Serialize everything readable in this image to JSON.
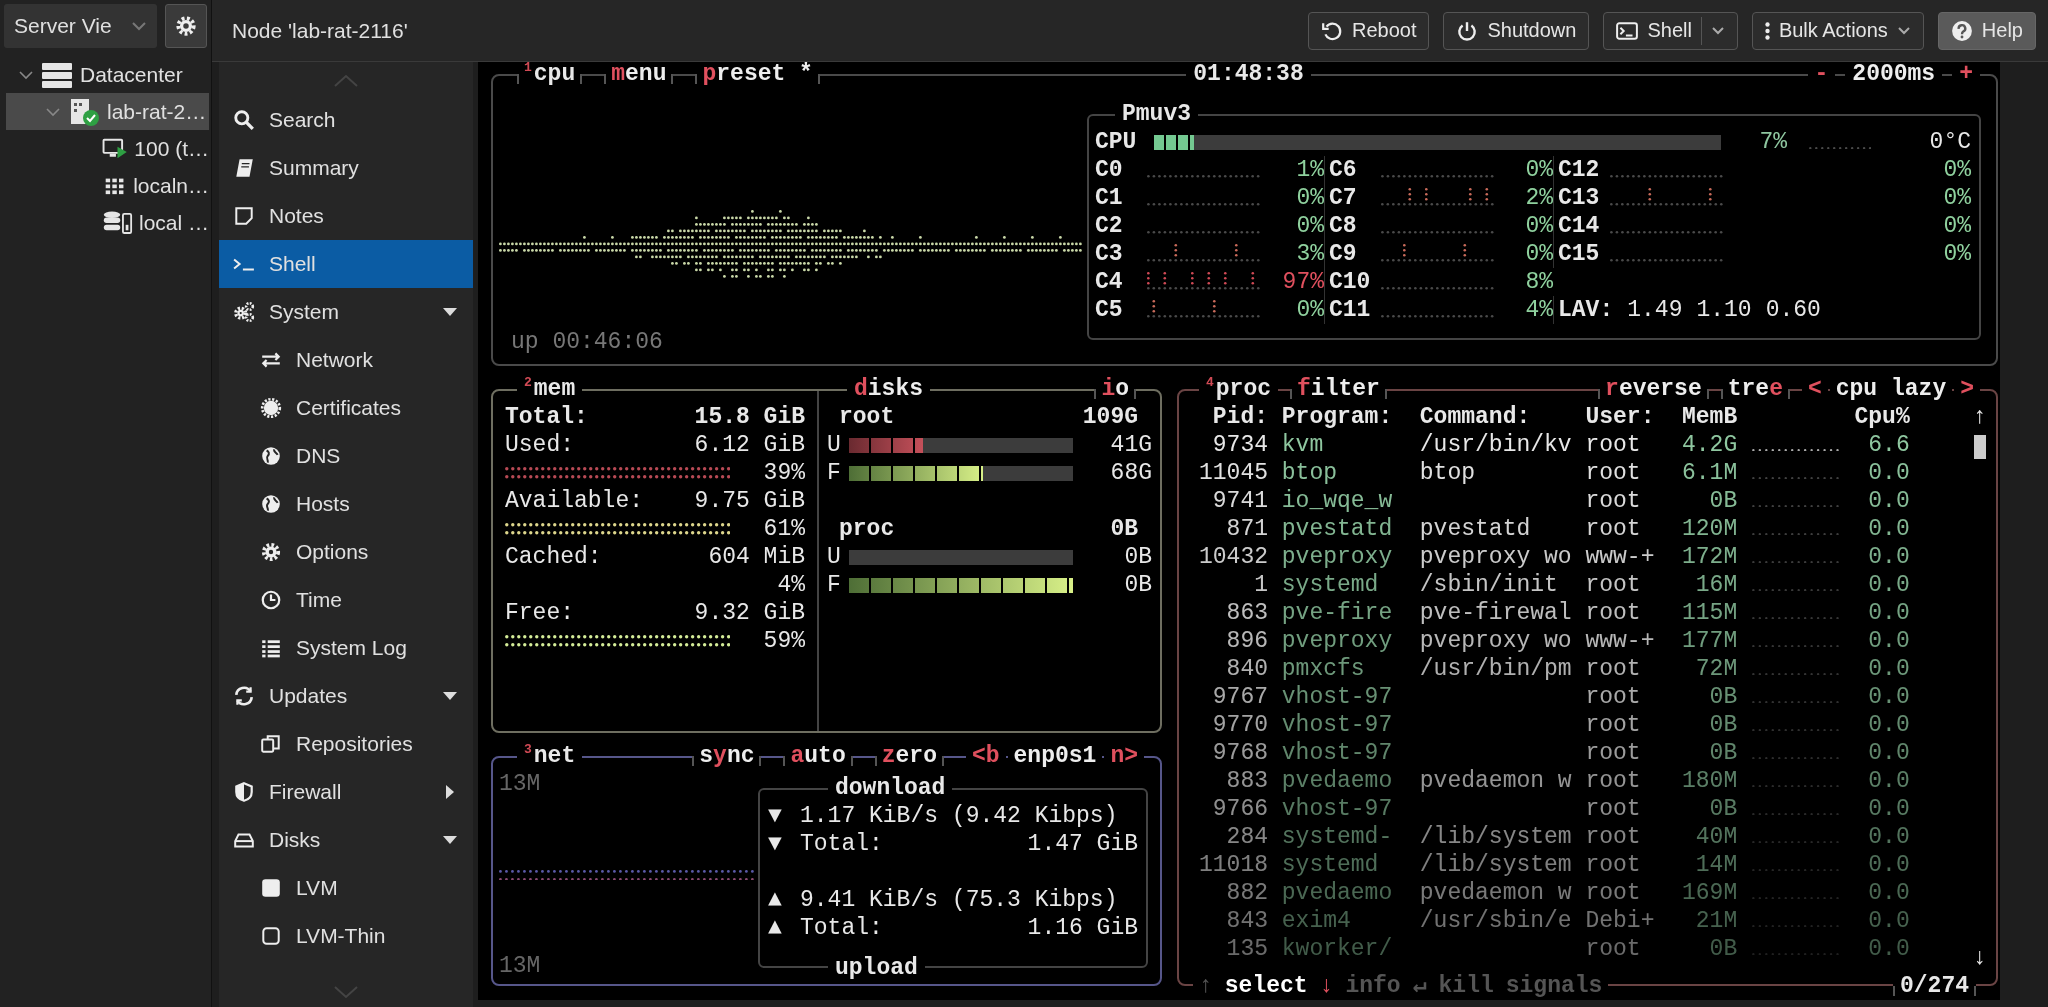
{
  "tree_panel": {
    "view_selector": {
      "value": "Server Vie"
    },
    "tree": [
      {
        "label": "Datacenter",
        "kind": "datacenter",
        "expanded": true,
        "selected": false,
        "children": [
          {
            "label": "lab-rat-2…",
            "kind": "node",
            "expanded": true,
            "selected": true,
            "children": [
              {
                "label": "100 (t…",
                "kind": "vm",
                "selected": false
              },
              {
                "label": "localn…",
                "kind": "sdn",
                "selected": false
              },
              {
                "label": "local …",
                "kind": "storage",
                "selected": false
              }
            ]
          }
        ]
      }
    ]
  },
  "header": {
    "title": "Node 'lab-rat-2116'",
    "buttons": [
      {
        "label": "Reboot",
        "kind": "reboot"
      },
      {
        "label": "Shutdown",
        "kind": "shutdown"
      },
      {
        "label": "Shell",
        "kind": "shell"
      },
      {
        "label": "Bulk Actions",
        "kind": "bulk"
      },
      {
        "label": "Help",
        "kind": "help"
      }
    ]
  },
  "nav": {
    "items": [
      {
        "label": "Search",
        "kind": "search",
        "selected": false
      },
      {
        "label": "Summary",
        "kind": "summary",
        "selected": false
      },
      {
        "label": "Notes",
        "kind": "notes",
        "selected": false
      },
      {
        "label": "Shell",
        "kind": "shell",
        "selected": true
      },
      {
        "label": "System",
        "kind": "system",
        "selected": false,
        "expanded": true,
        "children": [
          {
            "label": "Network",
            "kind": "network",
            "selected": false
          },
          {
            "label": "Certificates",
            "kind": "certificates",
            "selected": false
          },
          {
            "label": "DNS",
            "kind": "dns",
            "selected": false
          },
          {
            "label": "Hosts",
            "kind": "hosts",
            "selected": false
          },
          {
            "label": "Options",
            "kind": "options",
            "selected": false
          },
          {
            "label": "Time",
            "kind": "time",
            "selected": false
          },
          {
            "label": "System Log",
            "kind": "log",
            "selected": false
          }
        ]
      },
      {
        "label": "Updates",
        "kind": "updates",
        "selected": false,
        "expanded": true,
        "children": [
          {
            "label": "Repositories",
            "kind": "repositories",
            "selected": false
          }
        ]
      },
      {
        "label": "Firewall",
        "kind": "firewall",
        "selected": false,
        "expanded": false
      },
      {
        "label": "Disks",
        "kind": "disks",
        "selected": false,
        "expanded": true,
        "children": [
          {
            "label": "LVM",
            "kind": "lvm",
            "selected": false
          },
          {
            "label": "LVM-Thin",
            "kind": "lvmthin",
            "selected": false
          }
        ]
      }
    ]
  },
  "terminal": {
    "cpu": {
      "index": "1",
      "title": "cpu",
      "options": [
        [
          {
            "text": "m",
            "hot": true
          },
          {
            "text": "enu",
            "hot": false
          }
        ],
        [
          {
            "text": "p",
            "hot": true
          },
          {
            "text": "reset *",
            "hot": false
          }
        ]
      ],
      "clock": "01:48:38",
      "interval": [
        [
          {
            "text": "-",
            "hot": true
          }
        ],
        [
          {
            "text": "2000ms",
            "hot": false
          }
        ],
        [
          {
            "text": "+",
            "hot": true
          }
        ]
      ],
      "uptime": "up 00:46:06",
      "cores_box": {
        "title": "Pmuv3",
        "total": {
          "label": "CPU",
          "level": 0.07,
          "percent": "7%",
          "temp": "0°C"
        },
        "cores": [
          {
            "name": "C0",
            "percent": "1%",
            "color": "#8fd19e"
          },
          {
            "name": "C1",
            "percent": "0%",
            "color": "#8fd19e"
          },
          {
            "name": "C2",
            "percent": "0%",
            "color": "#8fd19e"
          },
          {
            "name": "C3",
            "percent": "3%",
            "color": "#8fd19e"
          },
          {
            "name": "C4",
            "percent": "97%",
            "color": "#e0505e"
          },
          {
            "name": "C5",
            "percent": "0%",
            "color": "#8fd19e"
          },
          {
            "name": "C6",
            "percent": "0%",
            "color": "#8fd19e"
          },
          {
            "name": "C7",
            "percent": "2%",
            "color": "#8fd19e"
          },
          {
            "name": "C8",
            "percent": "0%",
            "color": "#8fd19e"
          },
          {
            "name": "C9",
            "percent": "0%",
            "color": "#8fd19e"
          },
          {
            "name": "C10",
            "percent": "8%",
            "color": "#8fd19e"
          },
          {
            "name": "C11",
            "percent": "4%",
            "color": "#8fd19e"
          },
          {
            "name": "C12",
            "percent": "0%",
            "color": "#8fd19e"
          },
          {
            "name": "C13",
            "percent": "0%",
            "color": "#8fd19e"
          },
          {
            "name": "C14",
            "percent": "0%",
            "color": "#8fd19e"
          },
          {
            "name": "C15",
            "percent": "0%",
            "color": "#8fd19e"
          }
        ],
        "load": {
          "label": "LAV:",
          "values": [
            "1.49",
            "1.10",
            "0.60"
          ]
        }
      }
    },
    "mem": {
      "index": "2",
      "title": "mem",
      "rows": [
        {
          "kind": "total",
          "label": "Total:",
          "value": "15.8 GiB"
        },
        {
          "kind": "stat",
          "label": "Used:",
          "value": "6.12 GiB"
        },
        {
          "kind": "meter",
          "percent": "39%",
          "color": "#b84a55"
        },
        {
          "kind": "stat",
          "label": "Available:",
          "value": "9.75 GiB"
        },
        {
          "kind": "meter",
          "percent": "61%",
          "color": "#ddd68c"
        },
        {
          "kind": "stat",
          "label": "Cached:",
          "value": "604 MiB"
        },
        {
          "kind": "meter",
          "percent": "4%"
        },
        {
          "kind": "stat",
          "label": "Free:",
          "value": "9.32 GiB"
        },
        {
          "kind": "meter",
          "percent": "59%",
          "color": "#d4ec98"
        }
      ]
    },
    "disks": {
      "title": [
        {
          "text": "d",
          "hot": true
        },
        {
          "text": "isks",
          "hot": false
        }
      ],
      "io": [
        {
          "text": "i",
          "hot": true
        },
        {
          "text": "o",
          "hot": false
        }
      ],
      "disks": [
        {
          "name": "root",
          "size": "109G",
          "bars": [
            {
              "label": "U",
              "kind": "used",
              "level": 0.33,
              "value": "41G"
            },
            {
              "label": "F",
              "kind": "free",
              "level": 0.6,
              "value": "68G"
            }
          ]
        },
        {
          "name": "proc",
          "size": "0B",
          "bars": [
            {
              "label": "U",
              "kind": "used",
              "level": 0,
              "value": "0B"
            },
            {
              "label": "F",
              "kind": "free",
              "level": 1,
              "value": "0B"
            }
          ]
        }
      ]
    },
    "net": {
      "index": "3",
      "title": "net",
      "options": [
        [
          {
            "text": "s",
            "hot": false
          },
          {
            "text": "y",
            "hot": true
          },
          {
            "text": "nc",
            "hot": false
          }
        ],
        [
          {
            "text": "a",
            "hot": true
          },
          {
            "text": "uto",
            "hot": false
          }
        ],
        [
          {
            "text": "z",
            "hot": true
          },
          {
            "text": "ero",
            "hot": false
          }
        ]
      ],
      "interface": [
        [
          {
            "text": "<b",
            "hot": true
          }
        ],
        [
          {
            "text": "enp0s1",
            "hot": false
          }
        ],
        [
          {
            "text": "n>",
            "hot": true
          }
        ]
      ],
      "scale_top": "13M",
      "scale_bottom": "13M",
      "stats": {
        "download_title": "download",
        "upload_title": "upload",
        "download_rows": [
          {
            "arrow": "▼",
            "text": "1.17 KiB/s (9.42 Kibps)"
          },
          {
            "arrow": "▼",
            "label": "Total:",
            "value": "1.47 GiB"
          }
        ],
        "upload_rows": [
          {
            "arrow": "▲",
            "text": "9.41 KiB/s (75.3 Kibps)"
          },
          {
            "arrow": "▲",
            "label": "Total:",
            "value": "1.16 GiB"
          }
        ]
      }
    },
    "proc": {
      "index": "4",
      "title": "proc",
      "options": [
        [
          {
            "text": "f",
            "hot": true
          },
          {
            "text": "ilter",
            "hot": false
          }
        ]
      ],
      "right_options": [
        [
          {
            "text": "r",
            "hot": true
          },
          {
            "text": "everse",
            "hot": false
          }
        ],
        [
          {
            "text": "tre",
            "hot": false
          },
          {
            "text": "e",
            "hot": true
          }
        ]
      ],
      "sort": [
        [
          {
            "text": "<",
            "hot": true
          }
        ],
        [
          {
            "text": "cpu lazy",
            "hot": false
          }
        ],
        [
          {
            "text": ">",
            "hot": true
          }
        ]
      ],
      "columns": [
        "Pid:",
        "Program:",
        "Command:",
        "User:",
        "MemB",
        "Cpu%"
      ],
      "scroll_up": "↑",
      "scroll_down": "↓",
      "rows": [
        {
          "pid": "9734",
          "program": "kvm",
          "command": "/usr/bin/kv",
          "user": "root",
          "mem": "4.2G",
          "cpu": "6.6"
        },
        {
          "pid": "11045",
          "program": "btop",
          "command": "btop",
          "user": "root",
          "mem": "6.1M",
          "cpu": "0.0"
        },
        {
          "pid": "9741",
          "program": "io_wqe_w",
          "user": "root",
          "mem": "0B",
          "cpu": "0.0"
        },
        {
          "pid": "871",
          "program": "pvestatd",
          "command": "pvestatd",
          "user": "root",
          "mem": "120M",
          "cpu": "0.0"
        },
        {
          "pid": "10432",
          "program": "pveproxy",
          "command": "pveproxy wo",
          "user": "www-+",
          "mem": "172M",
          "cpu": "0.0"
        },
        {
          "pid": "1",
          "program": "systemd",
          "command": "/sbin/init",
          "user": "root",
          "mem": "16M",
          "cpu": "0.0"
        },
        {
          "pid": "863",
          "program": "pve-fire",
          "command": "pve-firewal",
          "user": "root",
          "mem": "115M",
          "cpu": "0.0"
        },
        {
          "pid": "896",
          "program": "pveproxy",
          "command": "pveproxy wo",
          "user": "www-+",
          "mem": "177M",
          "cpu": "0.0"
        },
        {
          "pid": "840",
          "program": "pmxcfs",
          "command": "/usr/bin/pm",
          "user": "root",
          "mem": "72M",
          "cpu": "0.0"
        },
        {
          "pid": "9767",
          "program": "vhost-97",
          "user": "root",
          "mem": "0B",
          "cpu": "0.0"
        },
        {
          "pid": "9770",
          "program": "vhost-97",
          "user": "root",
          "mem": "0B",
          "cpu": "0.0"
        },
        {
          "pid": "9768",
          "program": "vhost-97",
          "user": "root",
          "mem": "0B",
          "cpu": "0.0"
        },
        {
          "pid": "883",
          "program": "pvedaemo",
          "command": "pvedaemon w",
          "user": "root",
          "mem": "180M",
          "cpu": "0.0"
        },
        {
          "pid": "9766",
          "program": "vhost-97",
          "user": "root",
          "mem": "0B",
          "cpu": "0.0"
        },
        {
          "pid": "284",
          "program": "systemd-",
          "command": "/lib/system",
          "user": "root",
          "mem": "40M",
          "cpu": "0.0"
        },
        {
          "pid": "11018",
          "program": "systemd",
          "command": "/lib/system",
          "user": "root",
          "mem": "14M",
          "cpu": "0.0"
        },
        {
          "pid": "882",
          "program": "pvedaemo",
          "command": "pvedaemon w",
          "user": "root",
          "mem": "169M",
          "cpu": "0.0"
        },
        {
          "pid": "843",
          "program": "exim4",
          "command": "/usr/sbin/e",
          "user": "Debi+",
          "mem": "21M",
          "cpu": "0.0"
        },
        {
          "pid": "135",
          "program": "kworker/",
          "user": "root",
          "mem": "0B",
          "cpu": "0.0"
        }
      ],
      "footer": [
        {
          "text": "↑",
          "kind": "dim"
        },
        {
          "text": "select",
          "kind": "bright"
        },
        {
          "text": "↓",
          "kind": "hot"
        },
        {
          "text": "info",
          "kind": "dim"
        },
        {
          "text": "↵",
          "kind": "dim"
        },
        {
          "text": "kill",
          "kind": "dim"
        },
        {
          "text": "signals",
          "kind": "dim"
        }
      ],
      "count": "0/274"
    }
  }
}
